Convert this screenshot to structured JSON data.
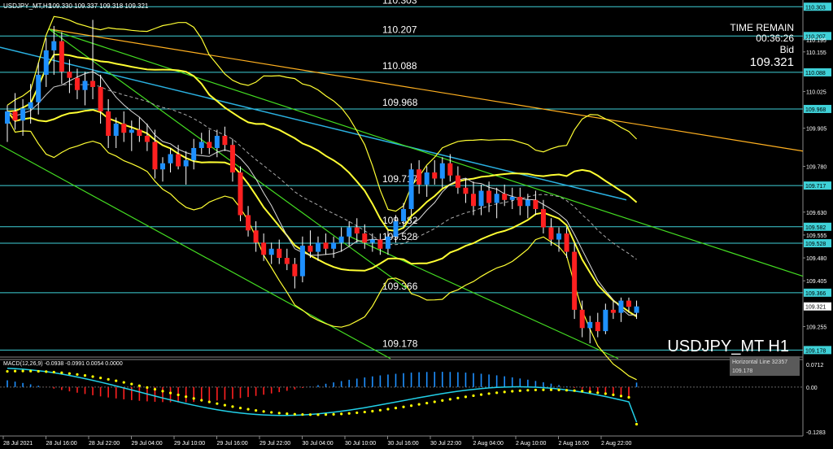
{
  "header": {
    "symbol_label": "USDJPY_MT,H1",
    "ohlc": "109.330 109.337 109.318 109.321"
  },
  "info": {
    "time_remain_label": "TIME REMAIN",
    "time_remain_value": "00:36:26",
    "bid_label": "Bid",
    "bid_value": "109.321"
  },
  "watermark": "USDJPY_MT H1",
  "macd": {
    "label": "MACD(12,26,9) -0.0938 -0.0991 0.0054 0.0000",
    "ticks": [
      "0.0712",
      "0.00",
      "-0.1283"
    ]
  },
  "tooltip": {
    "line1": "Horizontal Line 32357",
    "line2": "109.178"
  },
  "colors": {
    "background": "#000000",
    "bull_candle": "#1e90ff",
    "bear_candle": "#ff2020",
    "hline": "#3fd1d8",
    "bands": "#ffff33",
    "trend_green": "#44dd22",
    "trend_orange": "#ffb020",
    "ma_cyan": "#2ab0e0",
    "macd_signal": "#ffff00",
    "macd_main": "#22d0e8"
  },
  "chart_data": {
    "type": "candlestick",
    "symbol": "USDJPY_MT",
    "timeframe": "H1",
    "ylim": [
      109.155,
      110.325
    ],
    "price_ticks": [
      110.195,
      110.155,
      110.025,
      109.905,
      109.78,
      109.63,
      109.555,
      109.48,
      109.405,
      109.255
    ],
    "time_ticks": [
      "28 Jul 2021",
      "28 Jul 16:00",
      "28 Jul 22:00",
      "29 Jul 04:00",
      "29 Jul 10:00",
      "29 Jul 16:00",
      "29 Jul 22:00",
      "30 Jul 04:00",
      "30 Jul 10:00",
      "30 Jul 16:00",
      "30 Jul 22:00",
      "2 Aug 04:00",
      "2 Aug 10:00",
      "2 Aug 16:00",
      "2 Aug 22:00"
    ],
    "horizontal_levels": [
      110.303,
      110.207,
      110.088,
      109.968,
      109.717,
      109.582,
      109.528,
      109.366,
      109.178
    ],
    "current_price": 109.321,
    "candles": [
      {
        "o": 109.92,
        "h": 109.98,
        "l": 109.86,
        "c": 109.96
      },
      {
        "o": 109.96,
        "h": 110.02,
        "l": 109.9,
        "c": 109.93
      },
      {
        "o": 109.93,
        "h": 110.0,
        "l": 109.88,
        "c": 109.97
      },
      {
        "o": 109.97,
        "h": 110.05,
        "l": 109.92,
        "c": 109.99
      },
      {
        "o": 109.99,
        "h": 110.12,
        "l": 109.95,
        "c": 110.08
      },
      {
        "o": 110.08,
        "h": 110.2,
        "l": 110.04,
        "c": 110.16
      },
      {
        "o": 110.16,
        "h": 110.24,
        "l": 110.08,
        "c": 110.19
      },
      {
        "o": 110.19,
        "h": 110.22,
        "l": 110.05,
        "c": 110.09
      },
      {
        "o": 110.09,
        "h": 110.13,
        "l": 110.02,
        "c": 110.07
      },
      {
        "o": 110.07,
        "h": 110.1,
        "l": 110.0,
        "c": 110.03
      },
      {
        "o": 110.03,
        "h": 110.09,
        "l": 109.98,
        "c": 110.06
      },
      {
        "o": 110.06,
        "h": 110.26,
        "l": 110.0,
        "c": 110.04
      },
      {
        "o": 110.04,
        "h": 110.08,
        "l": 109.92,
        "c": 109.96
      },
      {
        "o": 109.96,
        "h": 110.0,
        "l": 109.84,
        "c": 109.88
      },
      {
        "o": 109.88,
        "h": 109.94,
        "l": 109.84,
        "c": 109.92
      },
      {
        "o": 109.92,
        "h": 109.96,
        "l": 109.86,
        "c": 109.89
      },
      {
        "o": 109.89,
        "h": 109.93,
        "l": 109.83,
        "c": 109.9
      },
      {
        "o": 109.9,
        "h": 109.94,
        "l": 109.86,
        "c": 109.88
      },
      {
        "o": 109.88,
        "h": 109.92,
        "l": 109.83,
        "c": 109.86
      },
      {
        "o": 109.86,
        "h": 109.9,
        "l": 109.74,
        "c": 109.77
      },
      {
        "o": 109.77,
        "h": 109.81,
        "l": 109.73,
        "c": 109.79
      },
      {
        "o": 109.79,
        "h": 109.84,
        "l": 109.76,
        "c": 109.82
      },
      {
        "o": 109.82,
        "h": 109.85,
        "l": 109.77,
        "c": 109.78
      },
      {
        "o": 109.78,
        "h": 109.83,
        "l": 109.72,
        "c": 109.8
      },
      {
        "o": 109.8,
        "h": 109.87,
        "l": 109.77,
        "c": 109.84
      },
      {
        "o": 109.84,
        "h": 109.89,
        "l": 109.82,
        "c": 109.86
      },
      {
        "o": 109.86,
        "h": 109.9,
        "l": 109.82,
        "c": 109.84
      },
      {
        "o": 109.84,
        "h": 109.9,
        "l": 109.81,
        "c": 109.88
      },
      {
        "o": 109.88,
        "h": 109.91,
        "l": 109.83,
        "c": 109.85
      },
      {
        "o": 109.85,
        "h": 109.87,
        "l": 109.73,
        "c": 109.76
      },
      {
        "o": 109.76,
        "h": 109.78,
        "l": 109.6,
        "c": 109.62
      },
      {
        "o": 109.62,
        "h": 109.65,
        "l": 109.55,
        "c": 109.57
      },
      {
        "o": 109.57,
        "h": 109.6,
        "l": 109.5,
        "c": 109.53
      },
      {
        "o": 109.53,
        "h": 109.56,
        "l": 109.47,
        "c": 109.49
      },
      {
        "o": 109.49,
        "h": 109.53,
        "l": 109.46,
        "c": 109.51
      },
      {
        "o": 109.51,
        "h": 109.54,
        "l": 109.46,
        "c": 109.48
      },
      {
        "o": 109.48,
        "h": 109.51,
        "l": 109.44,
        "c": 109.46
      },
      {
        "o": 109.46,
        "h": 109.48,
        "l": 109.38,
        "c": 109.42
      },
      {
        "o": 109.42,
        "h": 109.55,
        "l": 109.4,
        "c": 109.52
      },
      {
        "o": 109.52,
        "h": 109.57,
        "l": 109.48,
        "c": 109.5
      },
      {
        "o": 109.5,
        "h": 109.55,
        "l": 109.47,
        "c": 109.53
      },
      {
        "o": 109.53,
        "h": 109.56,
        "l": 109.49,
        "c": 109.51
      },
      {
        "o": 109.51,
        "h": 109.55,
        "l": 109.48,
        "c": 109.53
      },
      {
        "o": 109.53,
        "h": 109.58,
        "l": 109.5,
        "c": 109.55
      },
      {
        "o": 109.55,
        "h": 109.6,
        "l": 109.52,
        "c": 109.58
      },
      {
        "o": 109.58,
        "h": 109.61,
        "l": 109.53,
        "c": 109.56
      },
      {
        "o": 109.56,
        "h": 109.59,
        "l": 109.51,
        "c": 109.53
      },
      {
        "o": 109.53,
        "h": 109.56,
        "l": 109.5,
        "c": 109.54
      },
      {
        "o": 109.54,
        "h": 109.56,
        "l": 109.49,
        "c": 109.51
      },
      {
        "o": 109.51,
        "h": 109.57,
        "l": 109.49,
        "c": 109.55
      },
      {
        "o": 109.55,
        "h": 109.62,
        "l": 109.53,
        "c": 109.6
      },
      {
        "o": 109.6,
        "h": 109.66,
        "l": 109.58,
        "c": 109.64
      },
      {
        "o": 109.64,
        "h": 109.79,
        "l": 109.62,
        "c": 109.77
      },
      {
        "o": 109.77,
        "h": 109.8,
        "l": 109.69,
        "c": 109.72
      },
      {
        "o": 109.72,
        "h": 109.78,
        "l": 109.68,
        "c": 109.76
      },
      {
        "o": 109.76,
        "h": 109.8,
        "l": 109.72,
        "c": 109.74
      },
      {
        "o": 109.74,
        "h": 109.81,
        "l": 109.71,
        "c": 109.79
      },
      {
        "o": 109.79,
        "h": 109.82,
        "l": 109.73,
        "c": 109.75
      },
      {
        "o": 109.75,
        "h": 109.78,
        "l": 109.69,
        "c": 109.71
      },
      {
        "o": 109.71,
        "h": 109.74,
        "l": 109.66,
        "c": 109.69
      },
      {
        "o": 109.69,
        "h": 109.73,
        "l": 109.62,
        "c": 109.65
      },
      {
        "o": 109.65,
        "h": 109.72,
        "l": 109.62,
        "c": 109.7
      },
      {
        "o": 109.7,
        "h": 109.73,
        "l": 109.63,
        "c": 109.66
      },
      {
        "o": 109.66,
        "h": 109.71,
        "l": 109.61,
        "c": 109.69
      },
      {
        "o": 109.69,
        "h": 109.72,
        "l": 109.65,
        "c": 109.67
      },
      {
        "o": 109.67,
        "h": 109.71,
        "l": 109.64,
        "c": 109.68
      },
      {
        "o": 109.68,
        "h": 109.71,
        "l": 109.62,
        "c": 109.65
      },
      {
        "o": 109.65,
        "h": 109.69,
        "l": 109.61,
        "c": 109.67
      },
      {
        "o": 109.67,
        "h": 109.7,
        "l": 109.62,
        "c": 109.64
      },
      {
        "o": 109.64,
        "h": 109.67,
        "l": 109.56,
        "c": 109.58
      },
      {
        "o": 109.58,
        "h": 109.61,
        "l": 109.52,
        "c": 109.54
      },
      {
        "o": 109.54,
        "h": 109.58,
        "l": 109.5,
        "c": 109.56
      },
      {
        "o": 109.56,
        "h": 109.58,
        "l": 109.48,
        "c": 109.5
      },
      {
        "o": 109.5,
        "h": 109.53,
        "l": 109.28,
        "c": 109.31
      },
      {
        "o": 109.31,
        "h": 109.34,
        "l": 109.22,
        "c": 109.25
      },
      {
        "o": 109.25,
        "h": 109.29,
        "l": 109.2,
        "c": 109.27
      },
      {
        "o": 109.27,
        "h": 109.3,
        "l": 109.22,
        "c": 109.24
      },
      {
        "o": 109.24,
        "h": 109.33,
        "l": 109.23,
        "c": 109.31
      },
      {
        "o": 109.31,
        "h": 109.34,
        "l": 109.28,
        "c": 109.3
      },
      {
        "o": 109.3,
        "h": 109.35,
        "l": 109.27,
        "c": 109.34
      },
      {
        "o": 109.34,
        "h": 109.35,
        "l": 109.3,
        "c": 109.32
      },
      {
        "o": 109.3,
        "h": 109.34,
        "l": 109.28,
        "c": 109.321
      }
    ],
    "macd": {
      "label": "MACD(12,26,9)",
      "main": -0.0938,
      "signal": -0.0991,
      "histogram": 0.0054,
      "ylim": [
        -0.1283,
        0.0712
      ]
    }
  }
}
